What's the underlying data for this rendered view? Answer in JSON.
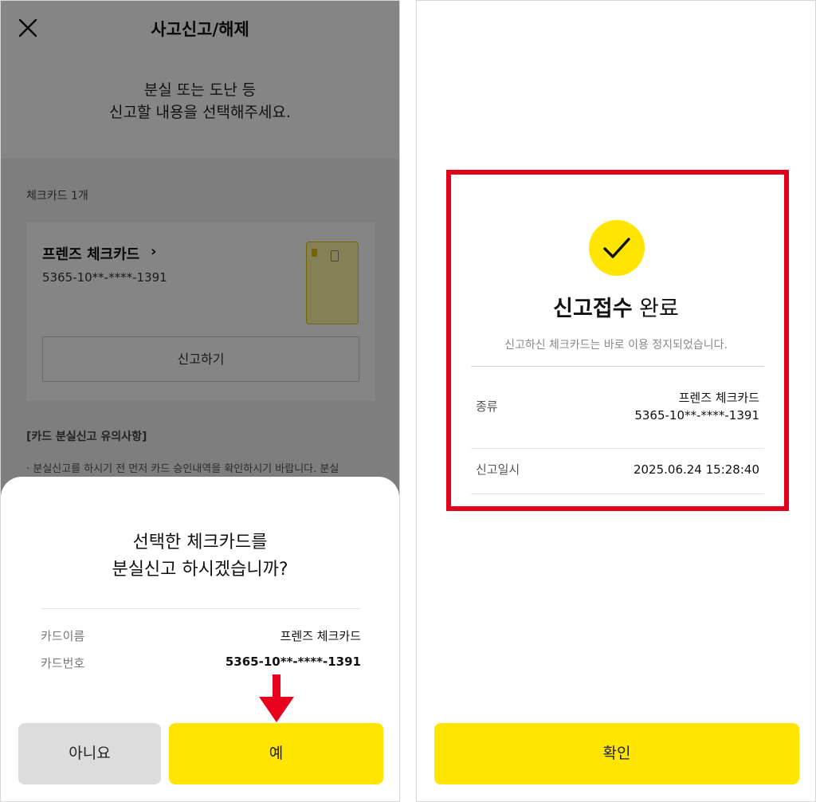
{
  "left": {
    "header": {
      "title": "사고신고/해제"
    },
    "intro": {
      "line1": "분실 또는 도난 등",
      "line2": "신고할 내용을 선택해주세요."
    },
    "section_label": "체크카드 1개",
    "card": {
      "name": "프렌즈 체크카드",
      "number": "5365-10**-****-1391",
      "report_button": "신고하기"
    },
    "notice": {
      "title": "[카드 분실신고 유의사항]",
      "text": "· 분실신고를 하시기 전 먼저 카드 승인내역을 확인하시기 바랍니다. 분실"
    },
    "sheet": {
      "question_line1": "선택한 체크카드를",
      "question_line2": "분실신고 하시겠습니까?",
      "rows": [
        {
          "label": "카드이름",
          "value": "프렌즈 체크카드"
        },
        {
          "label": "카드번호",
          "value": "5365-10**-****-1391"
        }
      ],
      "no_button": "아니요",
      "yes_button": "예"
    }
  },
  "right": {
    "title_bold": "신고접수",
    "title_rest": " 완료",
    "subtitle": "신고하신 체크카드는 바로 이용 정지되었습니다.",
    "rows": [
      {
        "label": "종류",
        "value_line1": "프렌즈 체크카드",
        "value_line2": "5365-10**-****-1391"
      },
      {
        "label": "신고일시",
        "value": "2025.06.24 15:28:40"
      }
    ],
    "confirm_button": "확인"
  },
  "colors": {
    "accent_yellow": "#ffe500",
    "highlight_red": "#e2001a",
    "arrow_red": "#e8001c"
  }
}
